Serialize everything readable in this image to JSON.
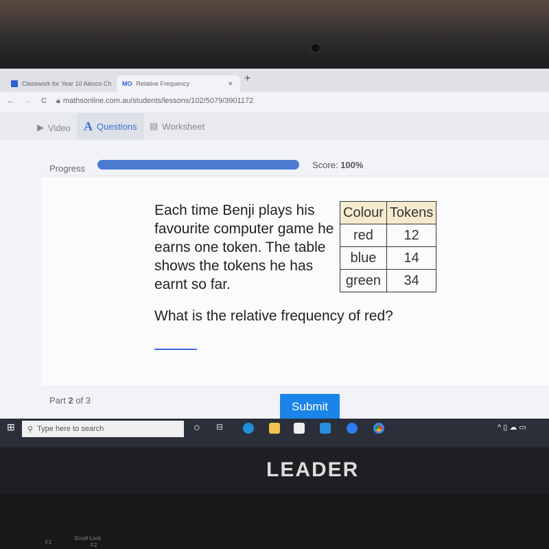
{
  "browser": {
    "tabs": [
      {
        "label": "Classwork for Year 10 Alesco Ch"
      },
      {
        "label": "Relative Frequency",
        "favicon": "MO"
      }
    ],
    "url": "mathsonline.com.au/students/lessons/102/5079/3901172"
  },
  "nav": {
    "video": "Video",
    "questions": "Questions",
    "worksheet": "Worksheet"
  },
  "progress": {
    "label": "Progress",
    "percent": 100,
    "score_label": "Score:",
    "score": "100%"
  },
  "question": {
    "text": "Each time Benji plays his favourite computer game he earns one token. The table shows the tokens he has earnt so far.",
    "prompt": "What is the relative frequency of red?",
    "answer": "",
    "table": {
      "headers": [
        "Colour",
        "Tokens"
      ],
      "rows": [
        [
          "red",
          "12"
        ],
        [
          "blue",
          "14"
        ],
        [
          "green",
          "34"
        ]
      ]
    }
  },
  "footer": {
    "part": "Part",
    "part_num": "2",
    "part_of": "of 3",
    "submit": "Submit"
  },
  "taskbar": {
    "search_placeholder": "Type here to search"
  },
  "laptop": {
    "brand": "LEADER",
    "keys": [
      "F1",
      "Scroll Lock",
      "F2"
    ]
  },
  "colors": {
    "accent": "#1b84e8",
    "progress": "#4a7bd1"
  }
}
